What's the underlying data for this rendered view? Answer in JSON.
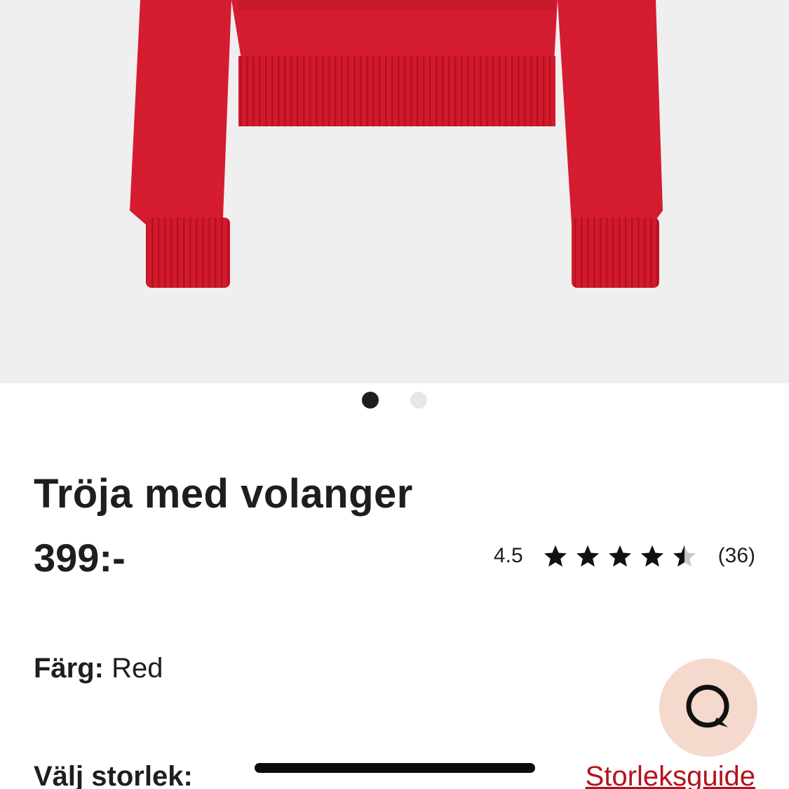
{
  "product": {
    "image_alt": "Red knitted cropped sweater",
    "title": "Tröja med volanger",
    "price": "399:-"
  },
  "gallery": {
    "image_count": 2,
    "active_index": 0
  },
  "rating": {
    "value": "4.5",
    "stars": 4.5,
    "max": 5,
    "count": "(36)"
  },
  "color": {
    "label": "Färg:",
    "value": "Red"
  },
  "size": {
    "label": "Välj storlek:",
    "guide_link": "Storleksguide"
  },
  "colors": {
    "sweater": "#d41a2e",
    "accent": "#b4121c",
    "chat_bg": "#f4d9cc"
  }
}
